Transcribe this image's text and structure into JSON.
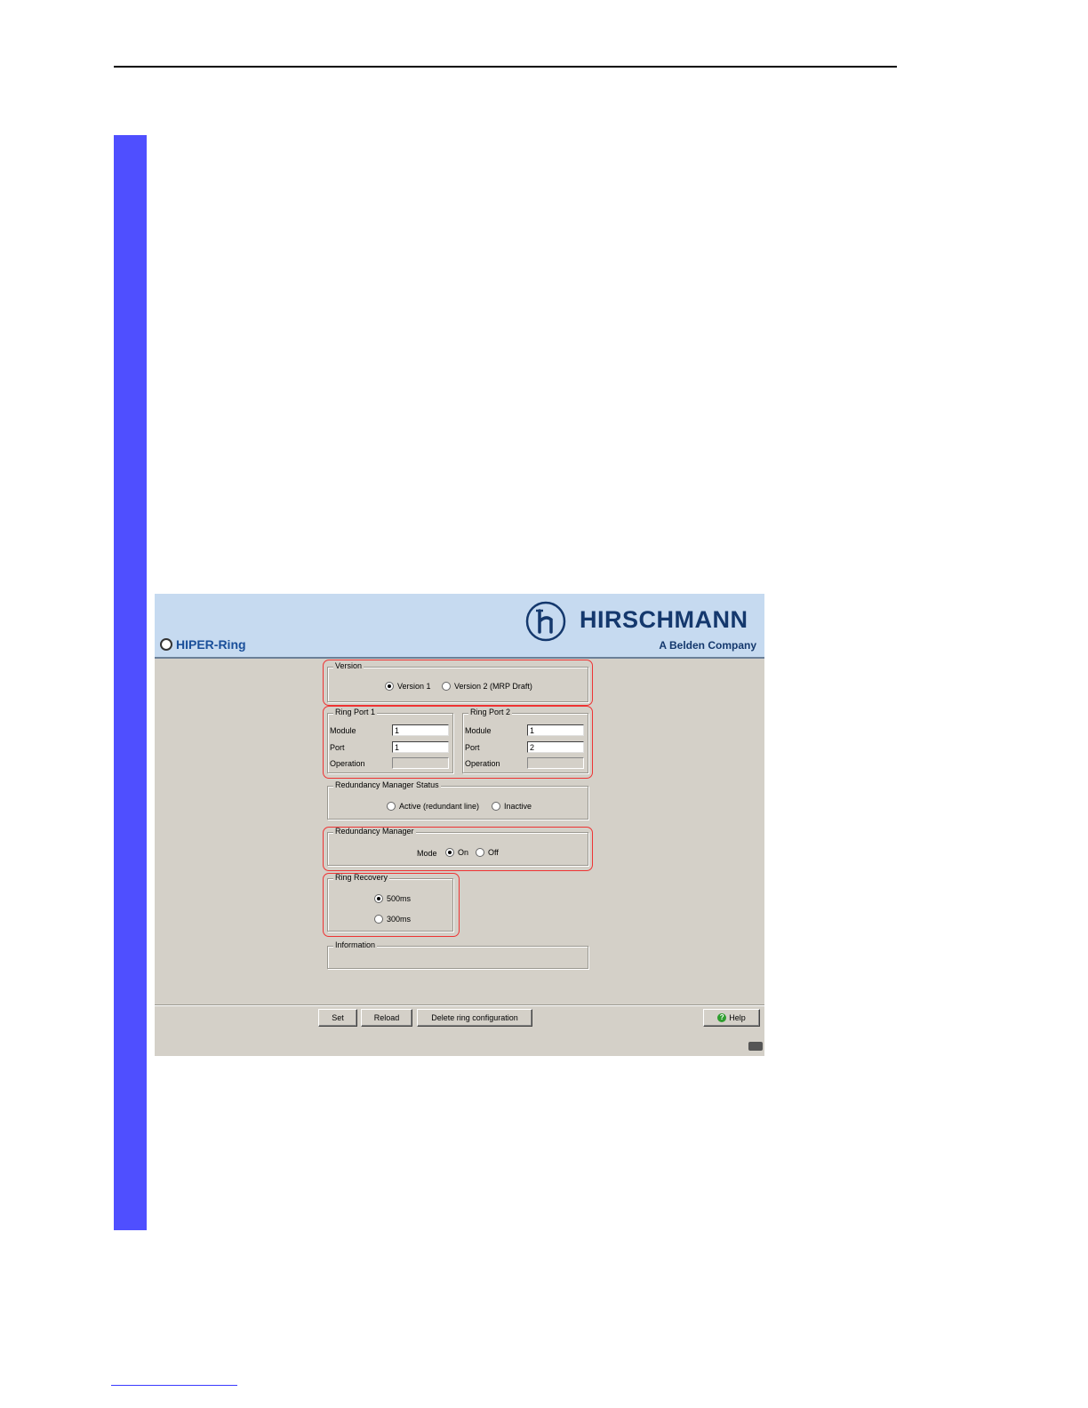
{
  "app": {
    "title": "HIPER-Ring",
    "brand": "HIRSCHMANN",
    "brand_sub": "A Belden Company"
  },
  "version_group": {
    "legend": "Version",
    "options": [
      "Version 1",
      "Version 2 (MRP Draft)"
    ],
    "selected": "Version 1"
  },
  "ring_port_1": {
    "legend": "Ring Port 1",
    "module_label": "Module",
    "module_value": "1",
    "port_label": "Port",
    "port_value": "1",
    "operation_label": "Operation",
    "operation_value": ""
  },
  "ring_port_2": {
    "legend": "Ring Port 2",
    "module_label": "Module",
    "module_value": "1",
    "port_label": "Port",
    "port_value": "2",
    "operation_label": "Operation",
    "operation_value": ""
  },
  "rm_status": {
    "legend": "Redundancy Manager Status",
    "options": [
      "Active (redundant line)",
      "Inactive"
    ],
    "selected": ""
  },
  "redundancy_manager": {
    "legend": "Redundancy Manager",
    "mode_label": "Mode",
    "options": [
      "On",
      "Off"
    ],
    "selected": "On"
  },
  "ring_recovery": {
    "legend": "Ring Recovery",
    "options": [
      "500ms",
      "300ms"
    ],
    "selected": "500ms"
  },
  "information": {
    "legend": "Information"
  },
  "buttons": {
    "set": "Set",
    "reload": "Reload",
    "delete": "Delete ring configuration",
    "help": "Help"
  },
  "colors": {
    "banner": "#c6daf0",
    "brand": "#14386d",
    "highlight": "#e33333",
    "side_bar": "#4f4fff"
  }
}
